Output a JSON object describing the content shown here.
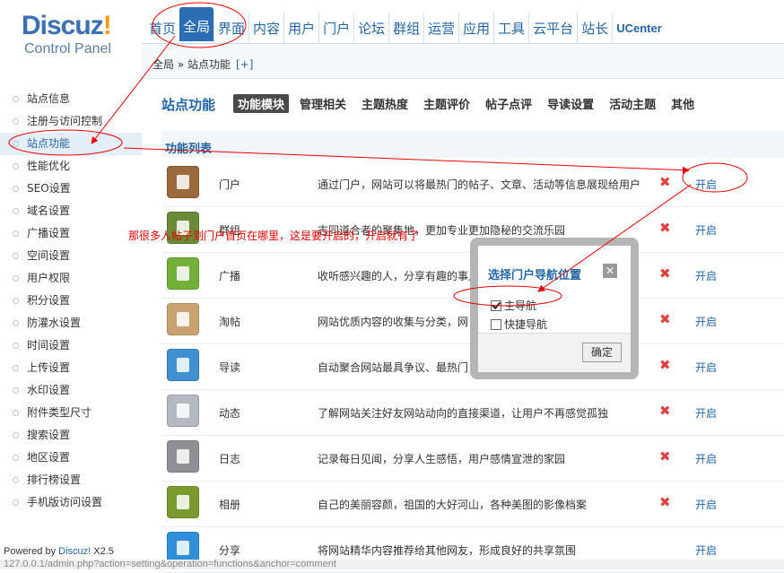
{
  "logo": {
    "brand": "Discuz",
    "bang": "!",
    "sub": "Control Panel"
  },
  "topnav": [
    {
      "label": "首页"
    },
    {
      "label": "全局",
      "active": true
    },
    {
      "label": "界面"
    },
    {
      "label": "内容"
    },
    {
      "label": "用户"
    },
    {
      "label": "门户"
    },
    {
      "label": "论坛"
    },
    {
      "label": "群组"
    },
    {
      "label": "运营"
    },
    {
      "label": "应用"
    },
    {
      "label": "工具"
    },
    {
      "label": "云平台"
    },
    {
      "label": "站长"
    },
    {
      "label": "UCenter"
    }
  ],
  "breadcrumb": {
    "text": "全局 » 站点功能",
    "plus": "[+]"
  },
  "sidebar": [
    "站点信息",
    "注册与访问控制",
    "站点功能",
    "性能优化",
    "SEO设置",
    "域名设置",
    "广播设置",
    "空间设置",
    "用户权限",
    "积分设置",
    "防灌水设置",
    "时间设置",
    "上传设置",
    "水印设置",
    "附件类型尺寸",
    "搜索设置",
    "地区设置",
    "排行榜设置",
    "手机版访问设置"
  ],
  "sidebar_active_index": 2,
  "main": {
    "title": "站点功能",
    "tabs": [
      "功能模块",
      "管理相关",
      "主题热度",
      "主题评价",
      "帖子点评",
      "导读设置",
      "活动主题",
      "其他"
    ],
    "list_header": "功能列表"
  },
  "features": [
    {
      "name": "门户",
      "desc": "通过门户，网站可以将最热门的帖子、文章、活动等信息展现给用户",
      "disabled_mark": "✖",
      "action": "开启",
      "color": "#9b6a3c"
    },
    {
      "name": "群组",
      "desc": "志同道合者的聚集地，更加专业更加隐秘的交流乐园",
      "disabled_mark": "✖",
      "action": "开启",
      "color": "#6a8a3a"
    },
    {
      "name": "广播",
      "desc": "收听感兴趣的人，分享有趣的事儿",
      "disabled_mark": "✖",
      "action": "开启",
      "color": "#73b03a"
    },
    {
      "name": "淘帖",
      "desc": "网站优质内容的收集与分类，网",
      "disabled_mark": "✖",
      "action": "开启",
      "color": "#c9a271"
    },
    {
      "name": "导读",
      "desc": "自动聚合网站最具争议、最热门",
      "disabled_mark": "✖",
      "action": "开启",
      "color": "#3f8fd2"
    },
    {
      "name": "动态",
      "desc": "了解网站关注好友网站动向的直接渠道，让用户不再感觉孤独",
      "disabled_mark": "✖",
      "action": "开启",
      "color": "#b4b8c0"
    },
    {
      "name": "日志",
      "desc": "记录每日见闻，分享人生感悟，用户感情宣泄的家园",
      "disabled_mark": "✖",
      "action": "开启",
      "color": "#8e9096"
    },
    {
      "name": "相册",
      "desc": "自己的美丽容颜，祖国的大好河山，各种美图的影像档案",
      "disabled_mark": "✖",
      "action": "开启",
      "color": "#7a9a2f"
    },
    {
      "name": "分享",
      "desc": "将网站精华内容推荐给其他网友，形成良好的共享氛围",
      "disabled_mark": "",
      "action": "开启",
      "color": "#2f8fd8"
    }
  ],
  "dialog": {
    "title": "选择门户导航位置",
    "close": "✕",
    "options": [
      {
        "label": "主导航",
        "checked": true
      },
      {
        "label": "快捷导航",
        "checked": false
      }
    ],
    "ok": "确定"
  },
  "annotation": {
    "text": "那很多人帖子到门户首页在哪里，这是要开启的，开启就有了"
  },
  "footer": {
    "powered_by": "Powered by",
    "brand": "Discuz!",
    "version": "X2.5"
  },
  "statusbar": {
    "url": "127.0.0.1/admin.php?action=setting&operation=functions&anchor=comment"
  }
}
